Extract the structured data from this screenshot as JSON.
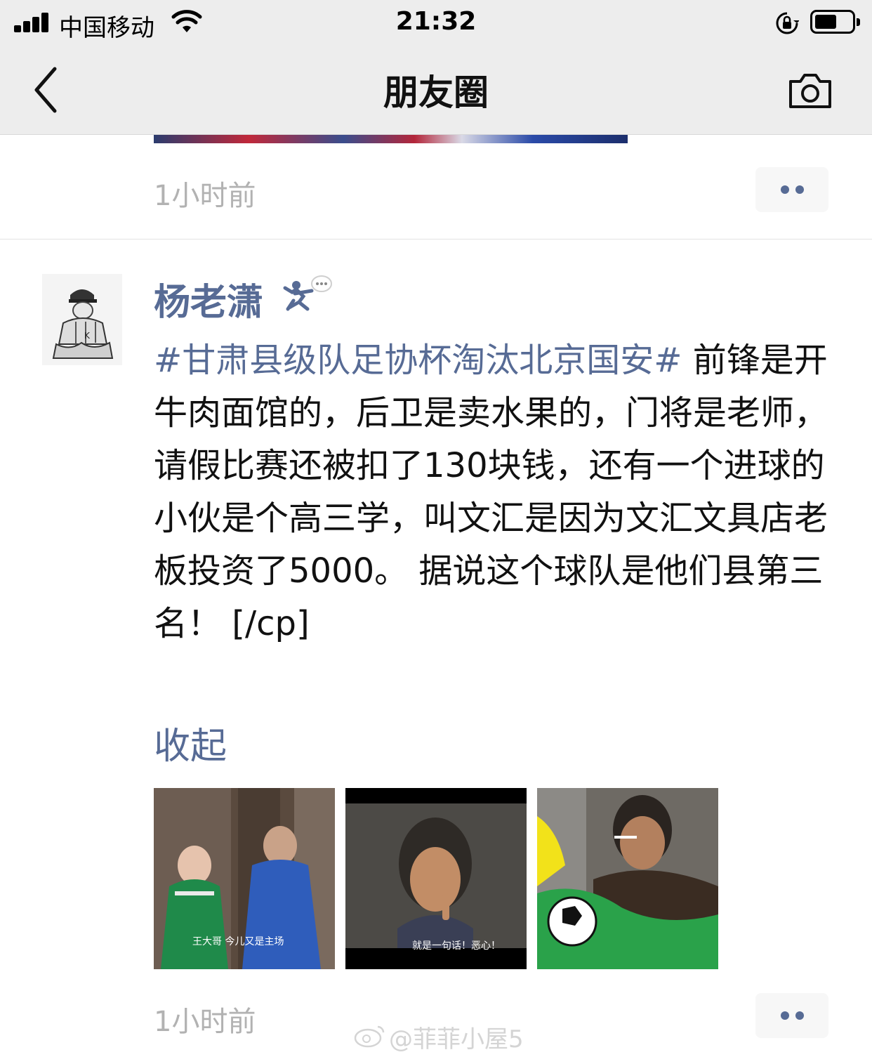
{
  "status_bar": {
    "carrier": "中国移动",
    "time": "21:32"
  },
  "nav": {
    "title": "朋友圈"
  },
  "previous_post": {
    "time": "1小时前"
  },
  "post": {
    "username": "杨老潇",
    "hashtag": "#甘肃县级队足协杯淘汰北京国安#",
    "body": " 前锋是开牛肉面馆的，后卫是卖水果的，门将是老师，请假比赛还被扣了130块钱，还有一个进球的小伙是个高三学，叫文汇是因为文汇文具店老板投资了5000。 据说这个球队是他们县第三名！ [/cp]",
    "collapse_label": "收起",
    "images": [
      {
        "caption": "王大哥  今儿又是主场"
      },
      {
        "caption": "就是一句话！恶心！"
      },
      {
        "caption": ""
      }
    ],
    "time": "1小时前"
  },
  "watermark": "@菲菲小屋5",
  "colors": {
    "link": "#576b95",
    "time": "#b2b2b2",
    "nav_bg": "#ededed"
  },
  "icons": [
    "signal-icon",
    "wifi-icon",
    "rotation-lock-icon",
    "battery-icon",
    "back-chevron-icon",
    "camera-icon",
    "more-dots-icon",
    "weibo-icon"
  ]
}
